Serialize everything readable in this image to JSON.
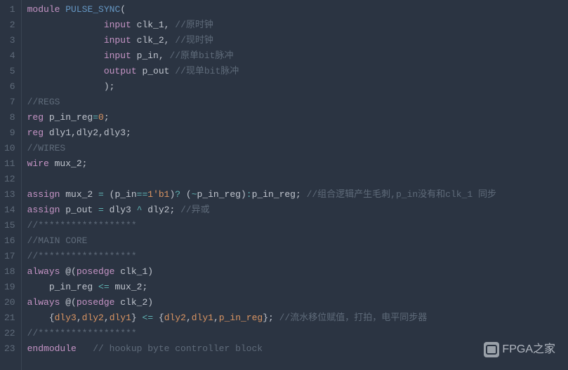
{
  "watermark": {
    "text": "FPGA之家"
  },
  "lines": [
    {
      "n": "1",
      "seg": [
        {
          "c": "kw",
          "t": "module"
        },
        {
          "t": " "
        },
        {
          "c": "fn",
          "t": "PULSE_SYNC"
        },
        {
          "t": "("
        }
      ]
    },
    {
      "n": "2",
      "seg": [
        {
          "t": "              "
        },
        {
          "c": "kw",
          "t": "input"
        },
        {
          "t": " clk_1, "
        },
        {
          "c": "cmt",
          "t": "//原时钟"
        }
      ]
    },
    {
      "n": "3",
      "seg": [
        {
          "t": "              "
        },
        {
          "c": "kw",
          "t": "input"
        },
        {
          "t": " clk_2, "
        },
        {
          "c": "cmt",
          "t": "//现时钟"
        }
      ]
    },
    {
      "n": "4",
      "seg": [
        {
          "t": "              "
        },
        {
          "c": "kw",
          "t": "input"
        },
        {
          "t": " p_in, "
        },
        {
          "c": "cmt",
          "t": "//原单bit脉冲"
        }
      ]
    },
    {
      "n": "5",
      "seg": [
        {
          "t": "              "
        },
        {
          "c": "kw",
          "t": "output"
        },
        {
          "t": " p_out "
        },
        {
          "c": "cmt",
          "t": "//现单bit脉冲"
        }
      ]
    },
    {
      "n": "6",
      "seg": [
        {
          "t": "              );"
        }
      ]
    },
    {
      "n": "7",
      "seg": [
        {
          "c": "cmt",
          "t": "//REGS"
        }
      ]
    },
    {
      "n": "8",
      "seg": [
        {
          "c": "kw",
          "t": "reg"
        },
        {
          "t": " p_in_reg"
        },
        {
          "c": "op",
          "t": "="
        },
        {
          "c": "num",
          "t": "0"
        },
        {
          "t": ";"
        }
      ]
    },
    {
      "n": "9",
      "seg": [
        {
          "c": "kw",
          "t": "reg"
        },
        {
          "t": " dly1,dly2,dly3;"
        }
      ]
    },
    {
      "n": "10",
      "seg": [
        {
          "c": "cmt",
          "t": "//WIRES"
        }
      ]
    },
    {
      "n": "11",
      "seg": [
        {
          "c": "kw",
          "t": "wire"
        },
        {
          "t": " mux_2;"
        }
      ]
    },
    {
      "n": "12",
      "seg": [
        {
          "t": ""
        }
      ]
    },
    {
      "n": "13",
      "seg": [
        {
          "c": "kw",
          "t": "assign"
        },
        {
          "t": " mux_2 "
        },
        {
          "c": "op",
          "t": "="
        },
        {
          "t": " (p_in"
        },
        {
          "c": "op",
          "t": "=="
        },
        {
          "c": "num",
          "t": "1'b1"
        },
        {
          "t": ")"
        },
        {
          "c": "op",
          "t": "?"
        },
        {
          "t": " ("
        },
        {
          "c": "op",
          "t": "~"
        },
        {
          "t": "p_in_reg)"
        },
        {
          "c": "op",
          "t": ":"
        },
        {
          "t": "p_in_reg; "
        },
        {
          "c": "cmt",
          "t": "//组合逻辑产生毛刺,p_in没有和clk_1 同步"
        }
      ]
    },
    {
      "n": "14",
      "seg": [
        {
          "c": "kw",
          "t": "assign"
        },
        {
          "t": " p_out "
        },
        {
          "c": "op",
          "t": "="
        },
        {
          "t": " dly3 "
        },
        {
          "c": "op",
          "t": "^"
        },
        {
          "t": " dly2; "
        },
        {
          "c": "cmt",
          "t": "//异或"
        }
      ]
    },
    {
      "n": "15",
      "seg": [
        {
          "c": "cmt",
          "t": "//******************"
        }
      ]
    },
    {
      "n": "16",
      "seg": [
        {
          "c": "cmt",
          "t": "//MAIN CORE"
        }
      ]
    },
    {
      "n": "17",
      "seg": [
        {
          "c": "cmt",
          "t": "//******************"
        }
      ]
    },
    {
      "n": "18",
      "seg": [
        {
          "c": "kw",
          "t": "always"
        },
        {
          "t": " @("
        },
        {
          "c": "kw",
          "t": "posedge"
        },
        {
          "t": " clk_1)"
        }
      ]
    },
    {
      "n": "19",
      "seg": [
        {
          "t": "    p_in_reg "
        },
        {
          "c": "op",
          "t": "<="
        },
        {
          "t": " mux_2;"
        }
      ]
    },
    {
      "n": "20",
      "seg": [
        {
          "c": "kw",
          "t": "always"
        },
        {
          "t": " @("
        },
        {
          "c": "kw",
          "t": "posedge"
        },
        {
          "t": " clk_2)"
        }
      ]
    },
    {
      "n": "21",
      "seg": [
        {
          "t": "    {"
        },
        {
          "c": "num",
          "t": "dly3"
        },
        {
          "t": ","
        },
        {
          "c": "num",
          "t": "dly2"
        },
        {
          "t": ","
        },
        {
          "c": "num",
          "t": "dly1"
        },
        {
          "t": "} "
        },
        {
          "c": "op",
          "t": "<="
        },
        {
          "t": " {"
        },
        {
          "c": "num",
          "t": "dly2"
        },
        {
          "t": ","
        },
        {
          "c": "num",
          "t": "dly1"
        },
        {
          "t": ","
        },
        {
          "c": "num",
          "t": "p_in_reg"
        },
        {
          "t": "}; "
        },
        {
          "c": "cmt",
          "t": "//流水移位赋值，打拍，电平同步器"
        }
      ]
    },
    {
      "n": "22",
      "seg": [
        {
          "c": "cmt",
          "t": "//******************"
        }
      ]
    },
    {
      "n": "23",
      "seg": [
        {
          "c": "kw",
          "t": "endmodule"
        },
        {
          "t": "   "
        },
        {
          "c": "cmt",
          "t": "// hookup byte controller block"
        }
      ]
    }
  ]
}
